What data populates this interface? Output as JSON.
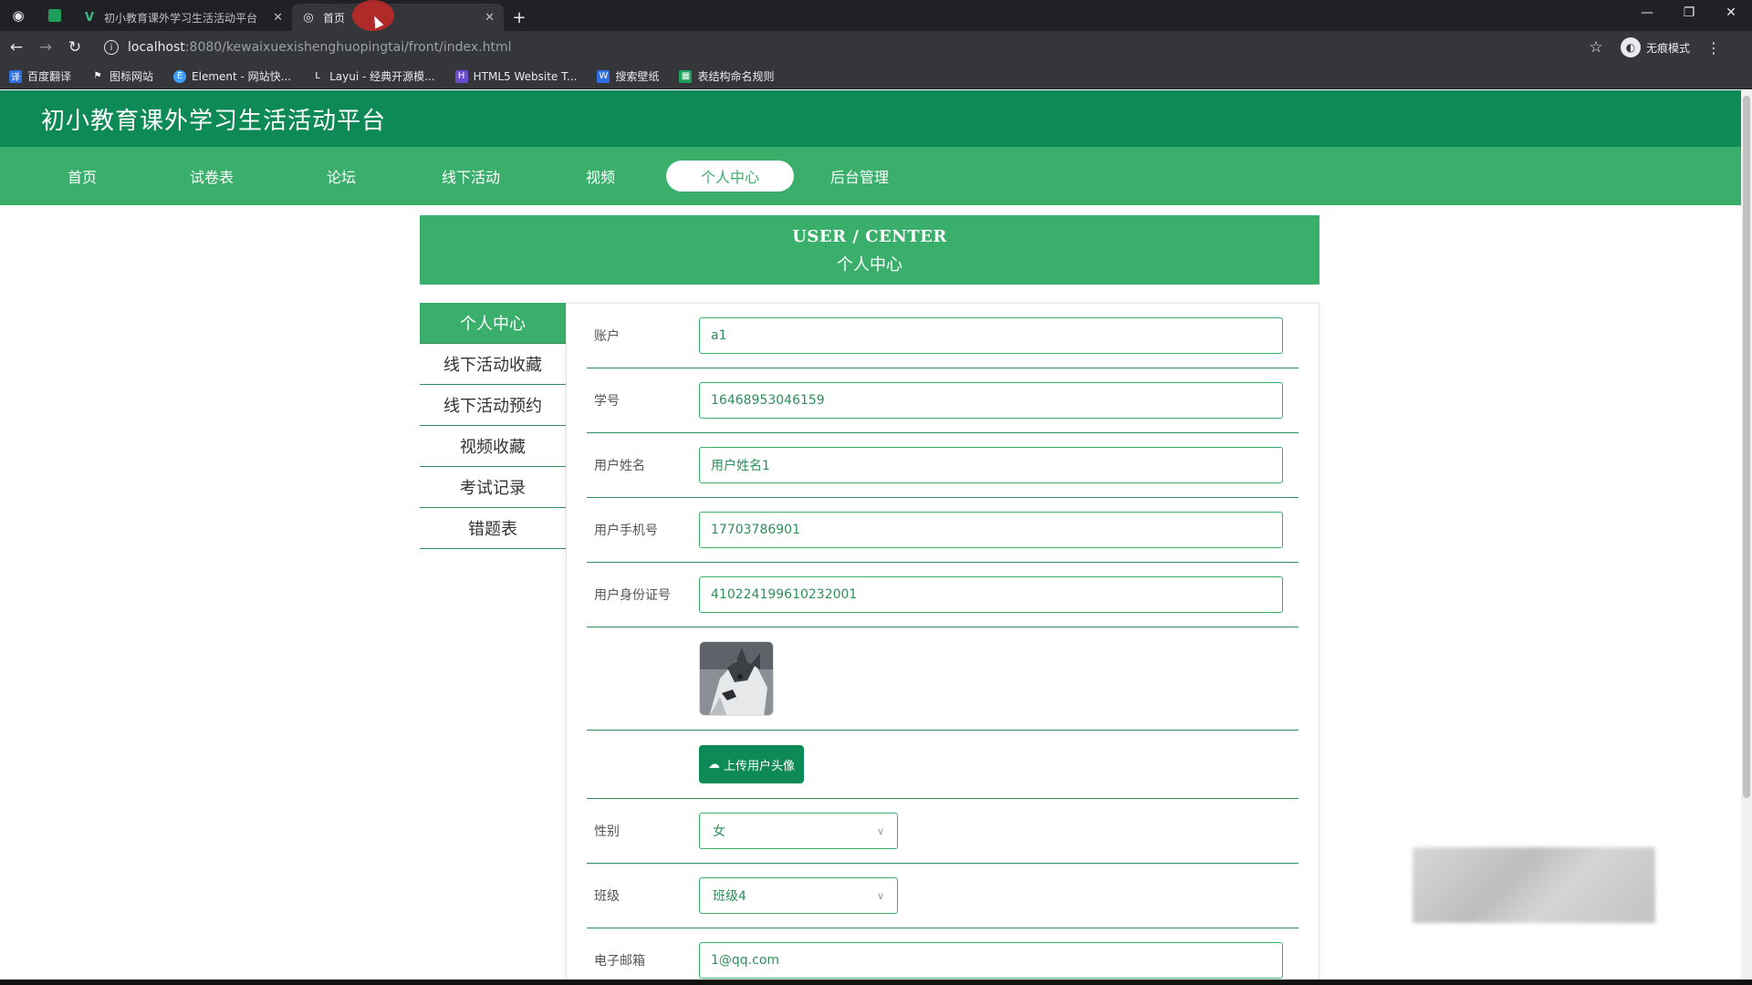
{
  "browser": {
    "tabs": [
      {
        "label": "初小教育课外学习生活活动平台",
        "active": false
      },
      {
        "label": "首页",
        "active": true
      }
    ],
    "url_host": "localhost",
    "url_path": ":8080/kewaixuexishenghuopingtai/front/index.html",
    "incognito_label": "无痕模式",
    "bookmarks": [
      "百度翻译",
      "图标网站",
      "Element - 网站快...",
      "Layui - 经典开源模...",
      "HTML5 Website T...",
      "搜索壁纸",
      "表结构命名规则"
    ]
  },
  "site": {
    "title": "初小教育课外学习生活活动平台",
    "nav": [
      "首页",
      "试卷表",
      "论坛",
      "线下活动",
      "视频",
      "个人中心",
      "后台管理"
    ],
    "active_nav": "个人中心"
  },
  "banner": {
    "en": "USER / CENTER",
    "cn": "个人中心"
  },
  "side_menu": [
    "个人中心",
    "线下活动收藏",
    "线下活动预约",
    "视频收藏",
    "考试记录",
    "错题表"
  ],
  "form": {
    "account": {
      "label": "账户",
      "value": "a1"
    },
    "student_no": {
      "label": "学号",
      "value": "16468953046159"
    },
    "name": {
      "label": "用户姓名",
      "value": "用户姓名1"
    },
    "phone": {
      "label": "用户手机号",
      "value": "17703786901"
    },
    "id_card": {
      "label": "用户身份证号",
      "value": "410224199610232001"
    },
    "upload_label": "上传用户头像",
    "gender": {
      "label": "性别",
      "value": "女"
    },
    "class": {
      "label": "班级",
      "value": "班级4"
    },
    "email": {
      "label": "电子邮箱",
      "value": "1@qq.com"
    }
  },
  "colors": {
    "header": "#0e8a57",
    "nav": "#3aaf6c",
    "accent": "#2e8f5a"
  }
}
